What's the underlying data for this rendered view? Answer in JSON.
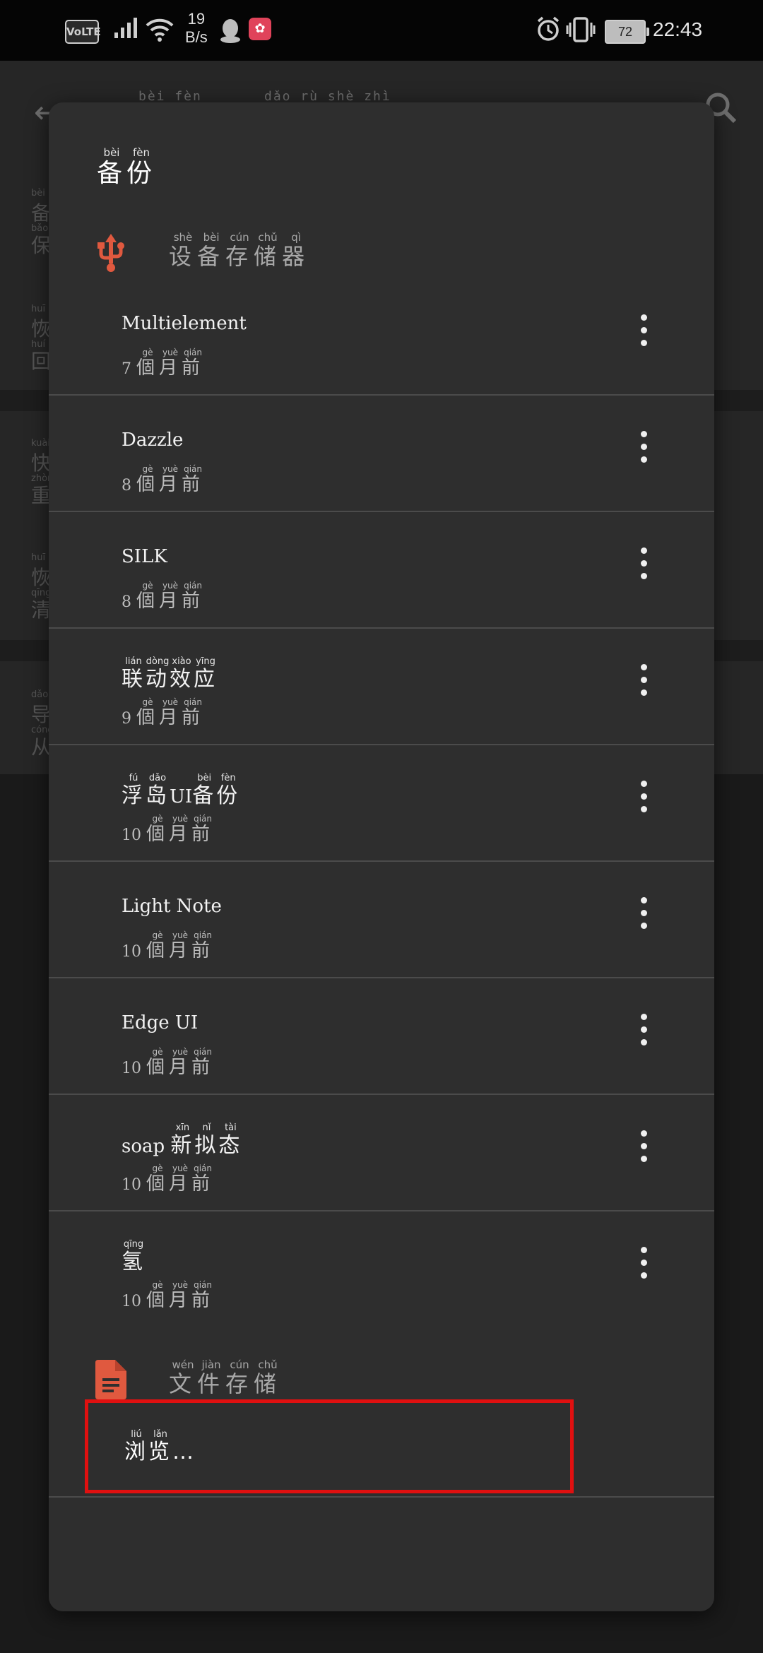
{
  "status_bar": {
    "volte": "VoLTE",
    "speed_value": "19",
    "speed_unit": "B/s",
    "battery": "72",
    "time": "22:43",
    "icons": [
      "signal-icon",
      "wifi-icon",
      "qq-icon",
      "app-icon",
      "alarm-icon",
      "vibrate-icon",
      "battery-icon"
    ]
  },
  "background": {
    "title_ruby_left": "bèi fèn",
    "title_ruby_right": "dǎo rù shè zhì",
    "items": [
      {
        "ruby": "bèi",
        "char": "备",
        "sub_ruby": "bǎo",
        "sub_char": "保"
      },
      {
        "ruby": "huī",
        "char": "恢",
        "sub_ruby": "huí",
        "sub_char": "回"
      },
      {
        "ruby": "kuài",
        "char": "快",
        "sub_ruby": "zhòng",
        "sub_char": "重"
      },
      {
        "ruby": "huī",
        "char": "恢",
        "sub_ruby": "qīng",
        "sub_char": "清"
      },
      {
        "ruby": "dǎo",
        "char": "导",
        "sub_ruby": "cóng",
        "sub_char": "从"
      }
    ]
  },
  "dialog": {
    "title": [
      {
        "c": "备",
        "p": "bèi"
      },
      {
        "c": "份",
        "p": "fèn"
      }
    ],
    "device_storage": [
      {
        "c": "设",
        "p": "shè"
      },
      {
        "c": "备",
        "p": "bèi"
      },
      {
        "c": "存",
        "p": "cún"
      },
      {
        "c": "储",
        "p": "chǔ"
      },
      {
        "c": "器",
        "p": "qì"
      }
    ],
    "file_storage": [
      {
        "c": "文",
        "p": "wén"
      },
      {
        "c": "件",
        "p": "jiàn"
      },
      {
        "c": "存",
        "p": "cún"
      },
      {
        "c": "储",
        "p": "chǔ"
      }
    ],
    "time_suffix": [
      {
        "c": "個",
        "p": "gè"
      },
      {
        "c": "月",
        "p": "yuè"
      },
      {
        "c": "前",
        "p": "qián"
      }
    ],
    "backups": [
      {
        "latin": "Multielement",
        "cjk": [],
        "months": "7"
      },
      {
        "latin": "Dazzle",
        "cjk": [],
        "months": "8"
      },
      {
        "latin": "SILK",
        "cjk": [],
        "months": "8"
      },
      {
        "latin": "",
        "cjk": [
          {
            "c": "联",
            "p": "lián"
          },
          {
            "c": "动",
            "p": "dòng"
          },
          {
            "c": "效",
            "p": "xiào"
          },
          {
            "c": "应",
            "p": "yīng"
          }
        ],
        "months": "9"
      },
      {
        "latin": "",
        "cjk_prefix": [
          {
            "c": "浮",
            "p": "fú"
          },
          {
            "c": "岛",
            "p": "dǎo"
          }
        ],
        "latin_mid": "UI",
        "cjk": [
          {
            "c": "备",
            "p": "bèi"
          },
          {
            "c": "份",
            "p": "fèn"
          }
        ],
        "months": "10"
      },
      {
        "latin": "Light Note",
        "cjk": [],
        "months": "10"
      },
      {
        "latin": "Edge UI",
        "cjk": [],
        "months": "10"
      },
      {
        "latin": "soap ",
        "cjk": [
          {
            "c": "新",
            "p": "xīn"
          },
          {
            "c": "拟",
            "p": "nǐ"
          },
          {
            "c": "态",
            "p": "tài"
          }
        ],
        "months": "10"
      },
      {
        "latin": "",
        "cjk": [
          {
            "c": "氢",
            "p": "qīng"
          }
        ],
        "months": "10"
      }
    ],
    "browse": [
      {
        "c": "浏",
        "p": "liú"
      },
      {
        "c": "览",
        "p": "lǎn"
      }
    ],
    "browse_suffix": "…"
  }
}
